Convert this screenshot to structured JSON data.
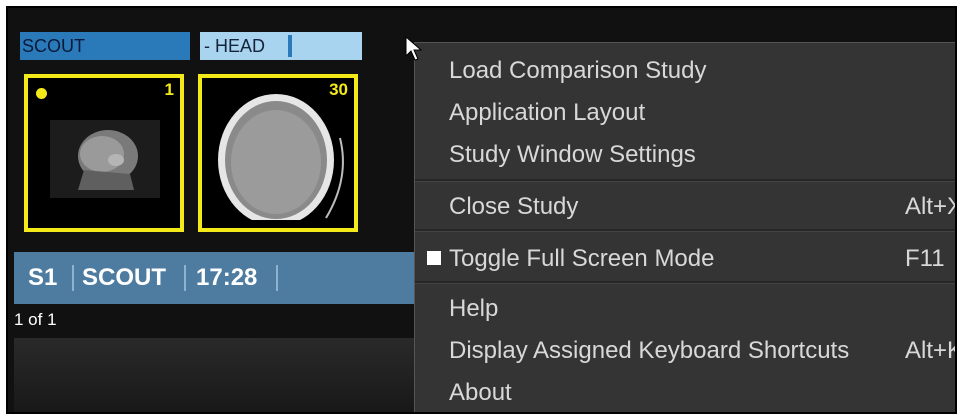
{
  "series_tabs": {
    "scout": "SCOUT",
    "head": "- HEAD"
  },
  "thumbnails": [
    {
      "number": "1"
    },
    {
      "number": "30"
    }
  ],
  "series_info": {
    "id": "S1",
    "name": "SCOUT",
    "time": "17:28"
  },
  "image_count": "1 of 1",
  "context_menu": {
    "items": [
      {
        "label": "Load Comparison Study",
        "submenu_icon": "chevron-right-icon"
      },
      {
        "label": "Application Layout",
        "submenu_icon": "chevron-right-icon"
      },
      {
        "label": "Study Window Settings",
        "submenu_icon": "chevron-right-icon"
      },
      {
        "label": "Close Study",
        "shortcut": "Alt+X"
      },
      {
        "label": "Toggle Full Screen Mode",
        "shortcut": "F11",
        "checked": true
      },
      {
        "label": "Help"
      },
      {
        "label": "Display Assigned Keyboard Shortcuts",
        "shortcut": "Alt+K"
      },
      {
        "label": "About"
      }
    ]
  },
  "colors": {
    "thumbnail_border": "#f4ea1a",
    "tab_active": "#2a79b8",
    "menu_bg": "#343434"
  }
}
